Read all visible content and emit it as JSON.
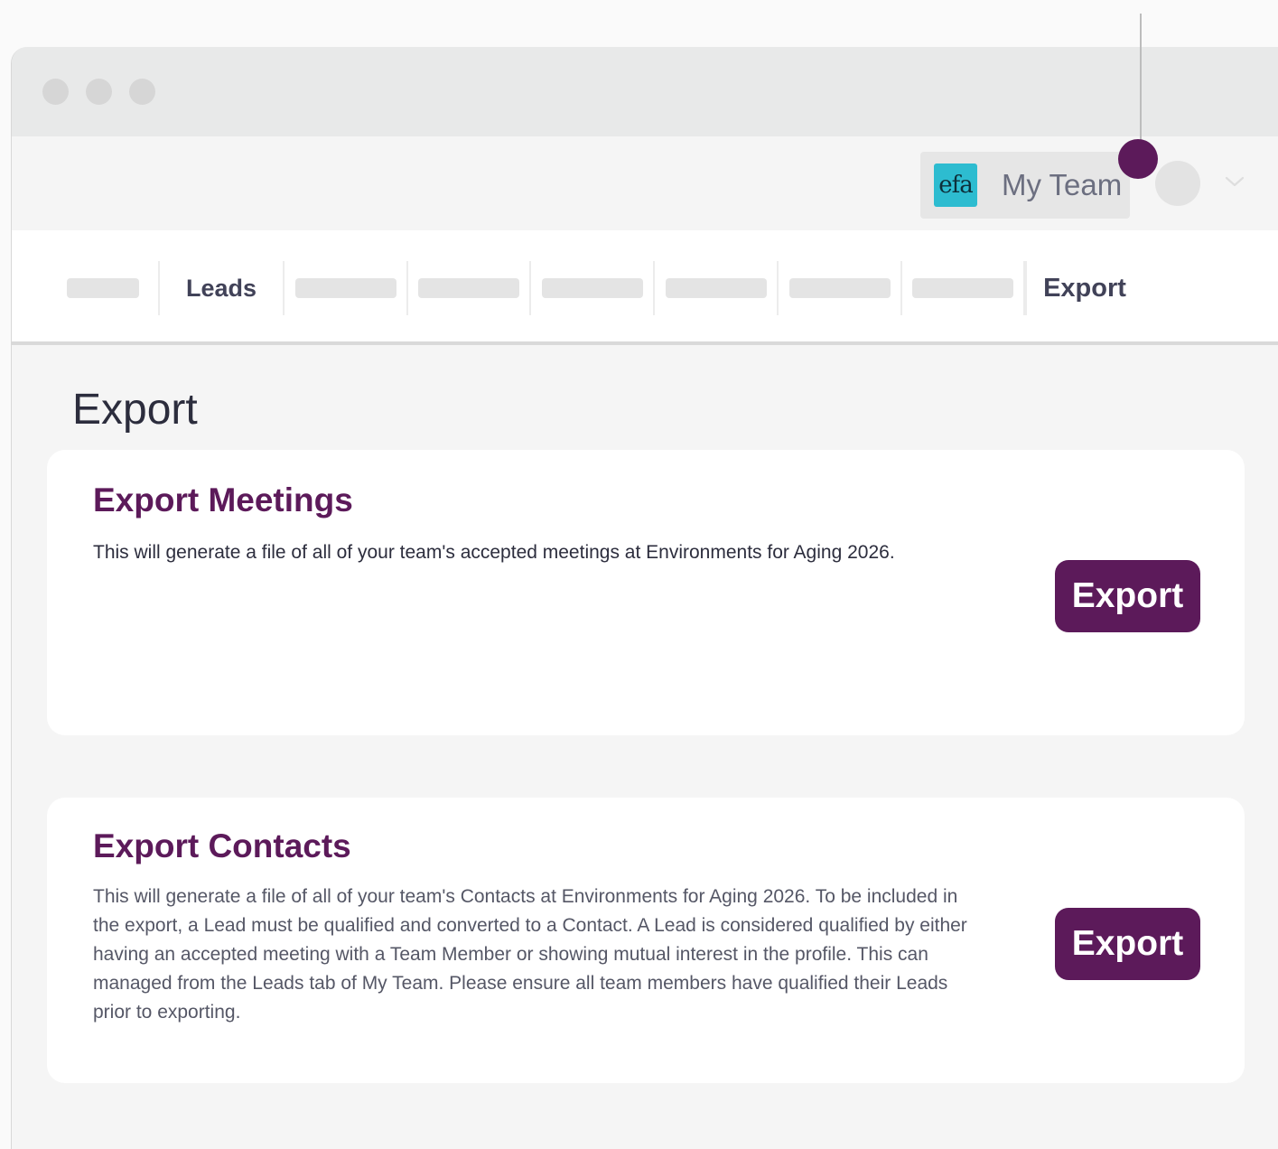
{
  "header": {
    "team_switcher": {
      "logo_text": "efa",
      "label": "My Team"
    }
  },
  "nav": {
    "tabs": [
      {
        "label": "",
        "placeholder": true
      },
      {
        "label": "Leads",
        "placeholder": false
      },
      {
        "label": "",
        "placeholder": true
      },
      {
        "label": "",
        "placeholder": true
      },
      {
        "label": "",
        "placeholder": true
      },
      {
        "label": "",
        "placeholder": true
      },
      {
        "label": "",
        "placeholder": true
      },
      {
        "label": "",
        "placeholder": true
      },
      {
        "label": "Export",
        "placeholder": false,
        "active": true
      }
    ]
  },
  "page": {
    "title": "Export"
  },
  "cards": [
    {
      "title": "Export Meetings",
      "description": "This will generate a file of all of your team's accepted meetings at Environments for Aging 2026.",
      "button_label": "Export"
    },
    {
      "title": "Export Contacts",
      "description": "This will generate a file of all of your team's Contacts at Environments for Aging 2026. To be included in the export, a Lead must be qualified and converted to a Contact. A Lead is considered qualified by either having an accepted meeting with a Team Member or showing mutual interest in the profile. This can managed from the Leads tab of My Team. Please ensure all team members have qualified their Leads prior to exporting.",
      "button_label": "Export"
    }
  ],
  "colors": {
    "accent": "#5c1a5a",
    "logo_bg": "#2dbcd0"
  }
}
